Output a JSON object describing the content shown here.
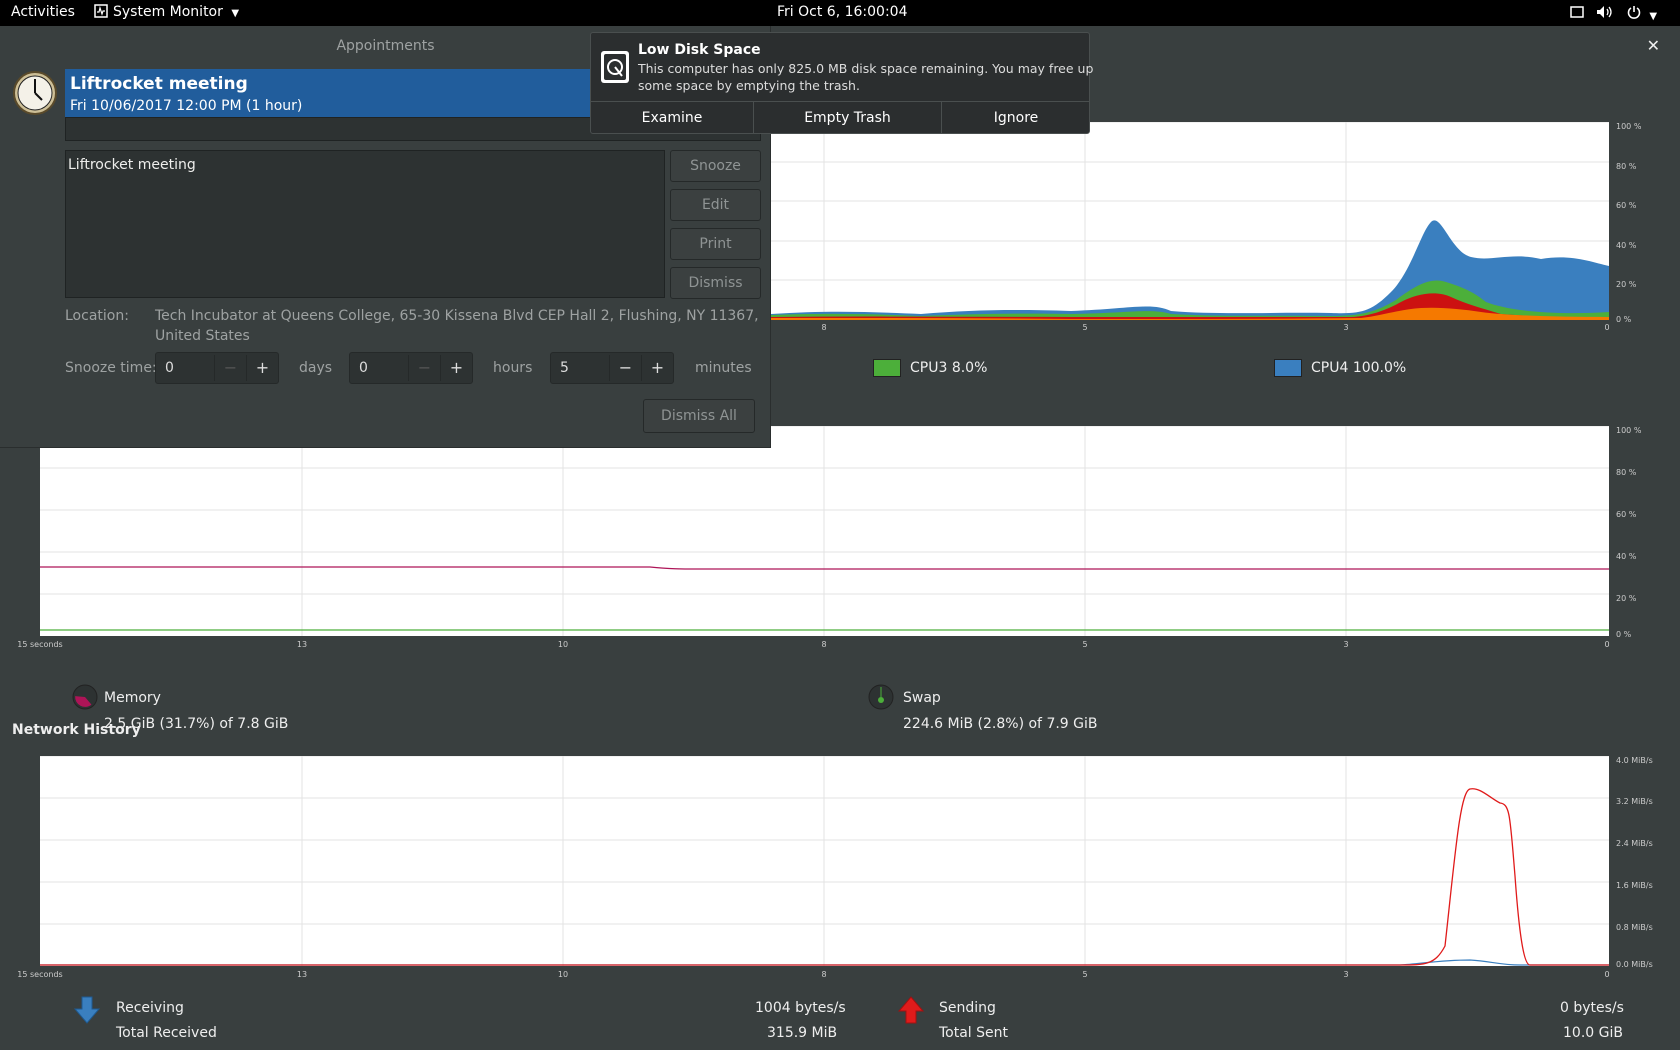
{
  "topbar": {
    "activities": "Activities",
    "app_menu": "System Monitor",
    "clock": "Fri Oct  6, 16:00:04"
  },
  "cpu": {
    "legend": [
      {
        "label": "CPU3",
        "value": "8.0%",
        "color": "#4caf3a"
      },
      {
        "label": "CPU4",
        "value": "100.0%",
        "color": "#3a7fbf"
      }
    ],
    "y_ticks": [
      "100 %",
      "80 %",
      "60 %",
      "40 %",
      "20 %",
      "0 %"
    ],
    "x_ticks": [
      "8",
      "5",
      "3",
      "0"
    ],
    "colors": {
      "orange": "#f57900",
      "red": "#cc1111",
      "green": "#4caf3a",
      "blue": "#3a7fbf"
    }
  },
  "memory": {
    "y_ticks": [
      "100 %",
      "80 %",
      "60 %",
      "40 %",
      "20 %",
      "0 %"
    ],
    "x_ticks": [
      "15 seconds",
      "13",
      "10",
      "8",
      "5",
      "3",
      "0"
    ],
    "memory_label": "Memory",
    "memory_value": "2.5 GiB (31.7%) of 7.8 GiB",
    "memory_pct": 31.7,
    "swap_label": "Swap",
    "swap_value": "224.6 MiB (2.8%) of 7.9 GiB",
    "swap_pct": 2.8,
    "memory_color": "#ad1457",
    "swap_color": "#4caf3a"
  },
  "network": {
    "title": "Network History",
    "y_ticks": [
      "4.0 MiB/s",
      "3.2 MiB/s",
      "2.4 MiB/s",
      "1.6 MiB/s",
      "0.8 MiB/s",
      "0.0 MiB/s"
    ],
    "x_ticks": [
      "15 seconds",
      "13",
      "10",
      "8",
      "5",
      "3",
      "0"
    ],
    "receiving_label": "Receiving",
    "receiving_value": "1004 bytes/s",
    "total_received_label": "Total Received",
    "total_received_value": "315.9 MiB",
    "sending_label": "Sending",
    "sending_value": "0 bytes/s",
    "total_sent_label": "Total Sent",
    "total_sent_value": "10.0 GiB",
    "receive_color": "#3a7fbf",
    "send_color": "#e01b1b"
  },
  "appointments": {
    "window_title": "Appointments",
    "event_title": "Liftrocket meeting",
    "event_time": "Fri 10/06/2017 12:00 PM (1 hour)",
    "description": "Liftrocket meeting",
    "buttons": {
      "snooze": "Snooze",
      "edit": "Edit",
      "print": "Print",
      "dismiss": "Dismiss",
      "dismiss_all": "Dismiss All"
    },
    "location_label": "Location:",
    "location_line1": "Tech Incubator at Queens College, 65-30 Kissena Blvd CEP Hall 2, Flushing, NY 11367,",
    "location_line2": "United States",
    "snooze_label": "Snooze time:",
    "days_value": "0",
    "days_label": "days",
    "hours_value": "0",
    "hours_label": "hours",
    "minutes_value": "5",
    "minutes_label": "minutes"
  },
  "notification": {
    "title": "Low Disk Space",
    "body_line1": "This computer has only 825.0 MB disk space remaining.  You may free up",
    "body_line2": "some space by emptying the trash.",
    "actions": {
      "examine": "Examine",
      "empty_trash": "Empty Trash",
      "ignore": "Ignore"
    }
  },
  "chart_data": [
    {
      "type": "area",
      "title": "",
      "x_label": "seconds",
      "x": [
        9,
        8,
        7,
        6,
        5,
        4,
        3,
        2.5,
        2,
        1.5,
        1,
        0.5,
        0
      ],
      "ylim": [
        0,
        100
      ],
      "series": [
        {
          "name": "CPU3",
          "values": [
            3,
            3,
            2,
            3,
            2,
            3,
            2,
            5,
            14,
            12,
            6,
            4,
            2
          ]
        },
        {
          "name": "CPU4",
          "values": [
            2,
            2,
            2,
            2,
            2,
            3,
            2,
            8,
            22,
            14,
            18,
            10,
            25
          ]
        }
      ]
    },
    {
      "type": "line",
      "title": "",
      "x": [
        15,
        13,
        10,
        8,
        5,
        3,
        0
      ],
      "ylim": [
        0,
        100
      ],
      "series": [
        {
          "name": "Memory",
          "values": [
            33,
            33,
            33,
            32,
            32,
            32,
            32
          ]
        },
        {
          "name": "Swap",
          "values": [
            3,
            3,
            3,
            3,
            3,
            3,
            3
          ]
        }
      ]
    },
    {
      "type": "line",
      "title": "Network History",
      "x": [
        15,
        13,
        10,
        8,
        5,
        3,
        2,
        1.8,
        1.5,
        1.2,
        1,
        0
      ],
      "ylim": [
        0,
        4.0
      ],
      "y_unit": "MiB/s",
      "series": [
        {
          "name": "Receiving",
          "values": [
            0,
            0,
            0,
            0,
            0,
            0,
            0,
            0.05,
            0.1,
            0.05,
            0,
            0
          ]
        },
        {
          "name": "Sending",
          "values": [
            0,
            0,
            0,
            0,
            0,
            0,
            0,
            0.2,
            3.4,
            3.1,
            0,
            0
          ]
        }
      ]
    }
  ]
}
